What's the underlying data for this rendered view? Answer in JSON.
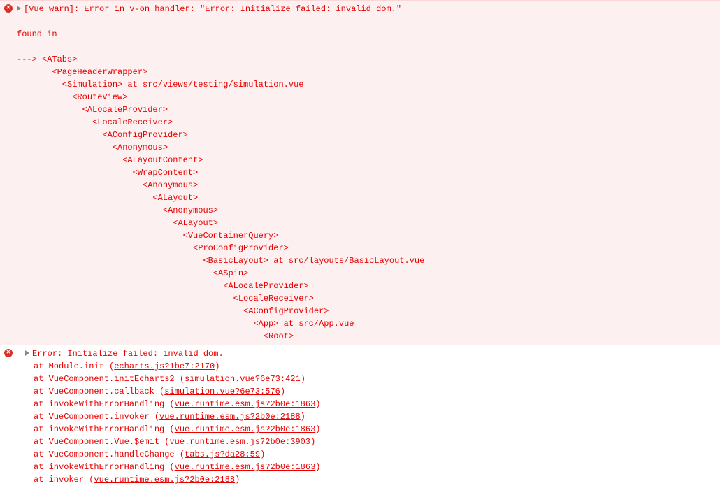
{
  "warn": {
    "header": "[Vue warn]: Error in v-on handler: \"Error: Initialize failed: invalid dom.\"",
    "found_in": "found in",
    "arrow": "---> ",
    "tree": [
      {
        "indent": 0,
        "text": "<ATabs>"
      },
      {
        "indent": 1,
        "text": "<PageHeaderWrapper>"
      },
      {
        "indent": 2,
        "text": "<Simulation> at src/views/testing/simulation.vue"
      },
      {
        "indent": 3,
        "text": "<RouteView>"
      },
      {
        "indent": 4,
        "text": "<ALocaleProvider>"
      },
      {
        "indent": 5,
        "text": "<LocaleReceiver>"
      },
      {
        "indent": 6,
        "text": "<AConfigProvider>"
      },
      {
        "indent": 7,
        "text": "<Anonymous>"
      },
      {
        "indent": 8,
        "text": "<ALayoutContent>"
      },
      {
        "indent": 9,
        "text": "<WrapContent>"
      },
      {
        "indent": 10,
        "text": "<Anonymous>"
      },
      {
        "indent": 11,
        "text": "<ALayout>"
      },
      {
        "indent": 12,
        "text": "<Anonymous>"
      },
      {
        "indent": 13,
        "text": "<ALayout>"
      },
      {
        "indent": 14,
        "text": "<VueContainerQuery>"
      },
      {
        "indent": 15,
        "text": "<ProConfigProvider>"
      },
      {
        "indent": 16,
        "text": "<BasicLayout> at src/layouts/BasicLayout.vue"
      },
      {
        "indent": 17,
        "text": "<ASpin>"
      },
      {
        "indent": 18,
        "text": "<ALocaleProvider>"
      },
      {
        "indent": 19,
        "text": "<LocaleReceiver>"
      },
      {
        "indent": 20,
        "text": "<AConfigProvider>"
      },
      {
        "indent": 21,
        "text": "<App> at src/App.vue"
      },
      {
        "indent": 22,
        "text": "<Root>"
      }
    ]
  },
  "error": {
    "header": "Error: Initialize failed: invalid dom.",
    "frames": [
      {
        "pre": "at Module.init (",
        "link": "echarts.js?1be7:2170",
        "post": ")"
      },
      {
        "pre": "at VueComponent.initEcharts2 (",
        "link": "simulation.vue?6e73:421",
        "post": ")"
      },
      {
        "pre": "at VueComponent.callback (",
        "link": "simulation.vue?6e73:576",
        "post": ")"
      },
      {
        "pre": "at invokeWithErrorHandling (",
        "link": "vue.runtime.esm.js?2b0e:1863",
        "post": ")"
      },
      {
        "pre": "at VueComponent.invoker (",
        "link": "vue.runtime.esm.js?2b0e:2188",
        "post": ")"
      },
      {
        "pre": "at invokeWithErrorHandling (",
        "link": "vue.runtime.esm.js?2b0e:1863",
        "post": ")"
      },
      {
        "pre": "at VueComponent.Vue.$emit (",
        "link": "vue.runtime.esm.js?2b0e:3903",
        "post": ")"
      },
      {
        "pre": "at VueComponent.handleChange (",
        "link": "tabs.js?da28:59",
        "post": ")"
      },
      {
        "pre": "at invokeWithErrorHandling (",
        "link": "vue.runtime.esm.js?2b0e:1863",
        "post": ")"
      },
      {
        "pre": "at invoker (",
        "link": "vue.runtime.esm.js?2b0e:2188",
        "post": ")"
      }
    ]
  }
}
